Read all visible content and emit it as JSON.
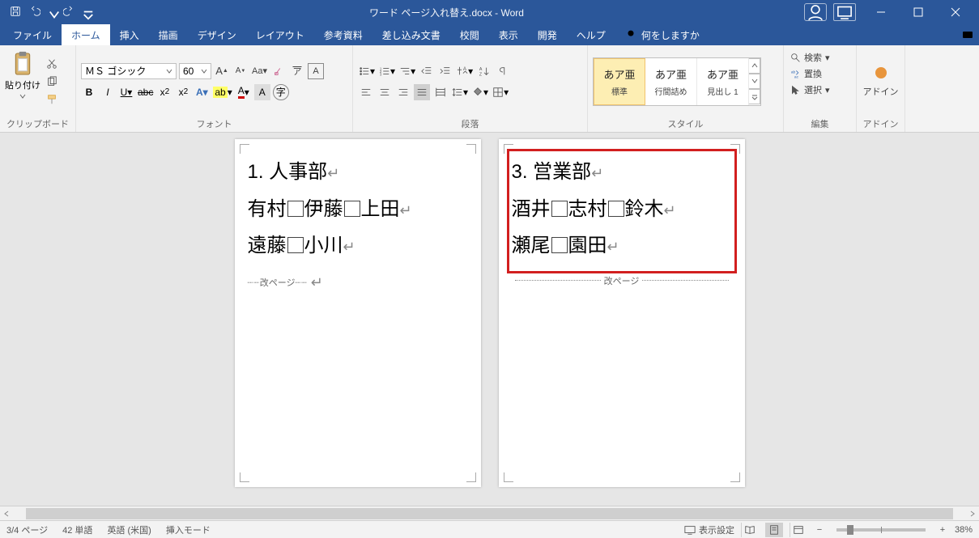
{
  "titlebar": {
    "document": "ワード ページ入れ替え.docx - Word"
  },
  "tabs": {
    "file": "ファイル",
    "home": "ホーム",
    "insert": "挿入",
    "draw": "描画",
    "design": "デザイン",
    "layout": "レイアウト",
    "references": "参考資料",
    "mailings": "差し込み文書",
    "review": "校閲",
    "view": "表示",
    "developer": "開発",
    "help": "ヘルプ",
    "tellme": "何をしますか"
  },
  "ribbon": {
    "clipboard": {
      "label": "クリップボード",
      "paste": "貼り付け"
    },
    "font": {
      "label": "フォント",
      "name": "ＭＳ ゴシック",
      "size": "60"
    },
    "paragraph": {
      "label": "段落"
    },
    "styles": {
      "label": "スタイル",
      "sample": "あア亜",
      "s1": "標準",
      "s2": "行間詰め",
      "s3": "見出し 1"
    },
    "editing": {
      "label": "編集",
      "find": "検索",
      "replace": "置換",
      "select": "選択"
    },
    "addins": {
      "label": "アドイン",
      "btn": "アドイン"
    }
  },
  "document": {
    "page1": {
      "heading": "1. 人事部",
      "line1a": "有村",
      "line1b": "伊藤",
      "line1c": "上田",
      "line2a": "遠藤",
      "line2b": "小川"
    },
    "page2": {
      "heading": "3. 営業部",
      "line1a": "酒井",
      "line1b": "志村",
      "line1c": "鈴木",
      "line2a": "瀬尾",
      "line2b": "園田"
    },
    "pagebreak": "改ページ"
  },
  "statusbar": {
    "page": "3/4 ページ",
    "words": "42 単語",
    "lang": "英語 (米国)",
    "mode": "挿入モード",
    "display": "表示設定",
    "zoom": "38%"
  }
}
